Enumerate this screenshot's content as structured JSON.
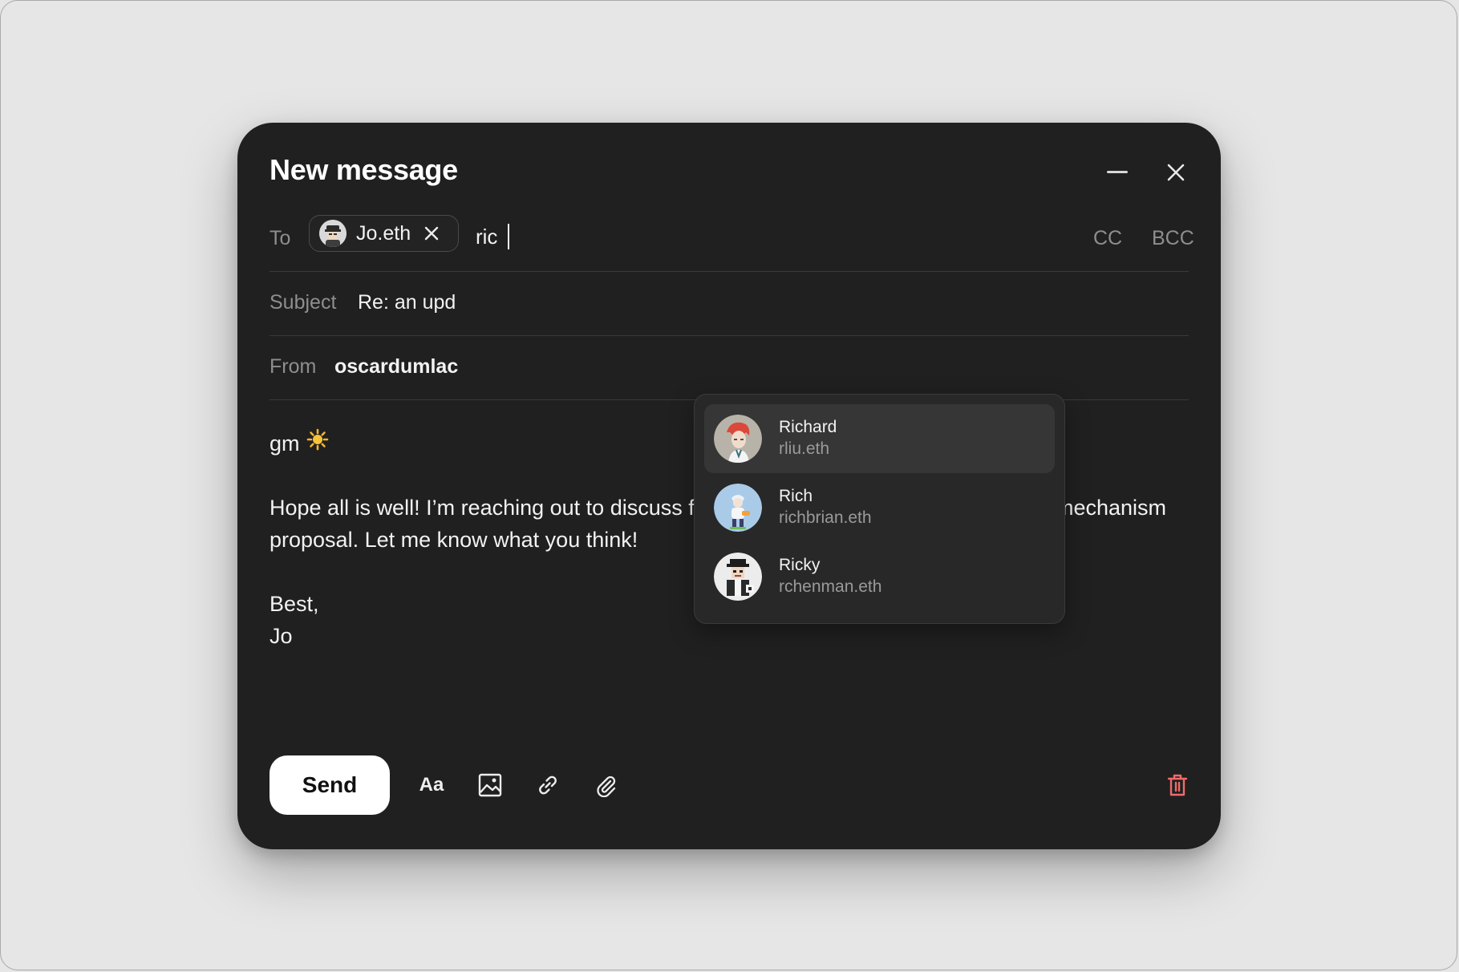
{
  "compose": {
    "title": "New message",
    "to_label": "To",
    "recipients": [
      {
        "label": "Jo.eth"
      }
    ],
    "to_input_value": "ric",
    "cc_label": "CC",
    "bcc_label": "BCC",
    "subject_label": "Subject",
    "subject_value": "Re: an upd",
    "from_label": "From",
    "from_value": "oscardumlac",
    "body": {
      "greeting": "gm",
      "paragraph": "Hope all is well! I’m reaching out to discuss further steps for finalizing our new fee mechanism proposal. Let me know what you think!",
      "signoff": "Best,",
      "signature": "Jo"
    }
  },
  "suggestions": [
    {
      "name": "Richard",
      "handle": "rliu.eth",
      "active": true
    },
    {
      "name": "Rich",
      "handle": "richbrian.eth",
      "active": false
    },
    {
      "name": "Ricky",
      "handle": "rchenman.eth",
      "active": false
    }
  ],
  "toolbar": {
    "send_label": "Send",
    "format_label": "Aa"
  },
  "icons": {
    "minimize": "minimize-icon",
    "close": "close-icon",
    "chip_remove": "close-icon",
    "sun": "sun-emoji-icon",
    "image": "image-icon",
    "link": "link-icon",
    "attach": "paperclip-icon",
    "trash": "trash-icon"
  },
  "colors": {
    "window_bg": "#202020",
    "page_bg": "#e6e6e6",
    "send_bg": "#ffffff",
    "trash": "#ef6b6b",
    "muted_text": "#8e8e8e"
  }
}
